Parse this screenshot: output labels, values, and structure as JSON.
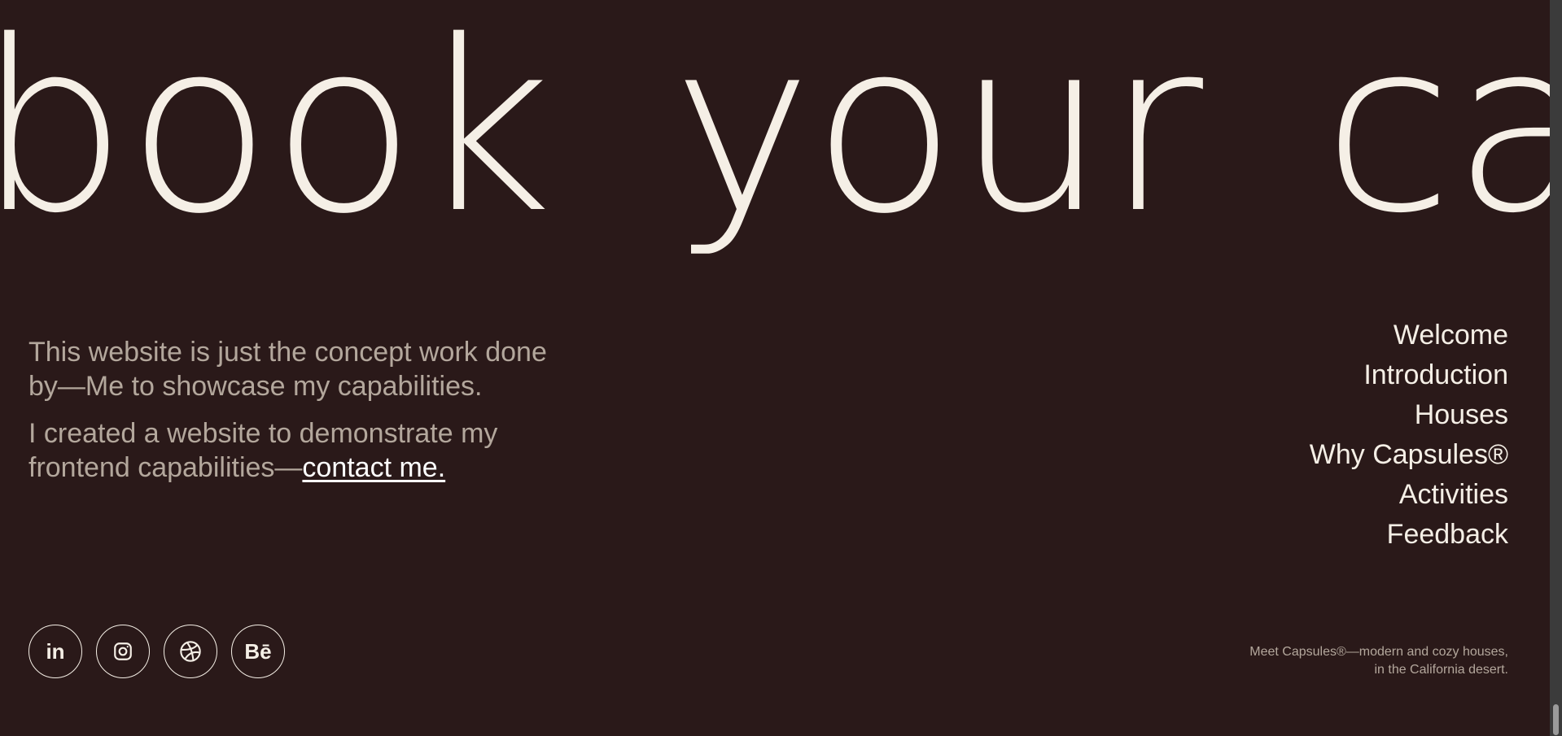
{
  "hero": {
    "marquee_text": "book your capsul"
  },
  "about": {
    "paragraph_1": "This website is just the concept work done by—Me to showcase my capabilities.",
    "paragraph_2_prefix": "I created a website to demonstrate my frontend capabilities—",
    "contact_link": "contact me."
  },
  "nav": {
    "items": [
      {
        "label": "Welcome"
      },
      {
        "label": "Introduction"
      },
      {
        "label": "Houses"
      },
      {
        "label": "Why Capsules®"
      },
      {
        "label": "Activities"
      },
      {
        "label": "Feedback"
      }
    ]
  },
  "socials": [
    {
      "icon": "linkedin-icon",
      "label": "in"
    },
    {
      "icon": "instagram-icon"
    },
    {
      "icon": "dribbble-icon"
    },
    {
      "icon": "behance-icon",
      "label": "Bē"
    }
  ],
  "footer": {
    "tagline_line_1": "Meet Capsules®—modern and cozy houses,",
    "tagline_line_2": "in the California desert."
  },
  "colors": {
    "background": "#2a1919",
    "text_light": "#f5efe6",
    "text_muted": "#b3a79c"
  }
}
